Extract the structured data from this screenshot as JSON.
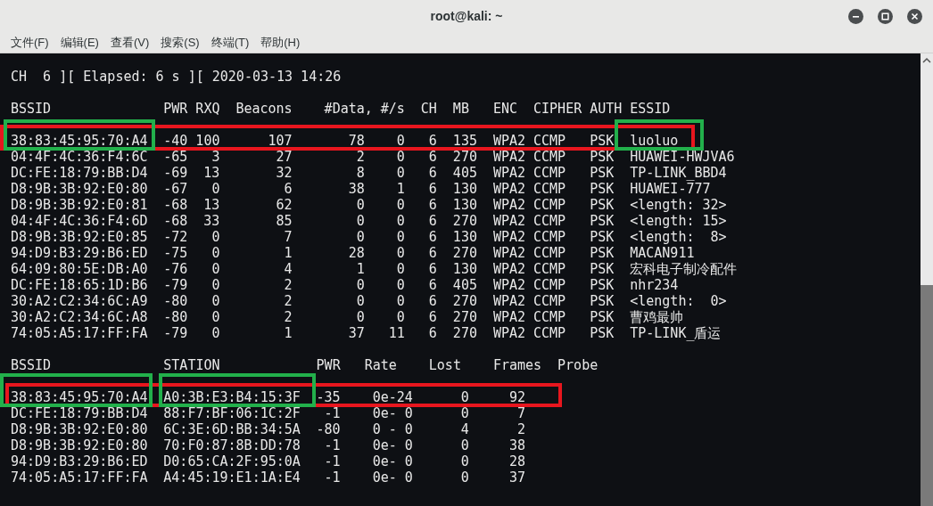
{
  "window": {
    "title": "root@kali: ~"
  },
  "menu": [
    "文件(F)",
    "编辑(E)",
    "查看(V)",
    "搜索(S)",
    "终端(T)",
    "帮助(H)"
  ],
  "status_line": "CH  6 ][ Elapsed: 6 s ][ 2020-03-13 14:26",
  "ap_table": {
    "columns": [
      "BSSID",
      "PWR",
      "RXQ",
      "Beacons",
      "#Data,",
      "#/s",
      "CH",
      "MB",
      "ENC",
      "CIPHER",
      "AUTH",
      "ESSID"
    ],
    "rows": [
      [
        "38:83:45:95:70:A4",
        "-40",
        "100",
        "107",
        "78",
        "0",
        "6",
        "135",
        "WPA2",
        "CCMP",
        "PSK",
        "luoluo"
      ],
      [
        "04:4F:4C:36:F4:6C",
        "-65",
        "3",
        "27",
        "2",
        "0",
        "6",
        "270",
        "WPA2",
        "CCMP",
        "PSK",
        "HUAWEI-HWJVA6"
      ],
      [
        "DC:FE:18:79:BB:D4",
        "-69",
        "13",
        "32",
        "8",
        "0",
        "6",
        "405",
        "WPA2",
        "CCMP",
        "PSK",
        "TP-LINK_BBD4"
      ],
      [
        "D8:9B:3B:92:E0:80",
        "-67",
        "0",
        "6",
        "38",
        "1",
        "6",
        "130",
        "WPA2",
        "CCMP",
        "PSK",
        "HUAWEI-777"
      ],
      [
        "D8:9B:3B:92:E0:81",
        "-68",
        "13",
        "62",
        "0",
        "0",
        "6",
        "130",
        "WPA2",
        "CCMP",
        "PSK",
        "<length: 32>"
      ],
      [
        "04:4F:4C:36:F4:6D",
        "-68",
        "33",
        "85",
        "0",
        "0",
        "6",
        "270",
        "WPA2",
        "CCMP",
        "PSK",
        "<length: 15>"
      ],
      [
        "D8:9B:3B:92:E0:85",
        "-72",
        "0",
        "7",
        "0",
        "0",
        "6",
        "130",
        "WPA2",
        "CCMP",
        "PSK",
        "<length:  8>"
      ],
      [
        "94:D9:B3:29:B6:ED",
        "-75",
        "0",
        "1",
        "28",
        "0",
        "6",
        "270",
        "WPA2",
        "CCMP",
        "PSK",
        "MACAN911"
      ],
      [
        "64:09:80:5E:DB:A0",
        "-76",
        "0",
        "4",
        "1",
        "0",
        "6",
        "130",
        "WPA2",
        "CCMP",
        "PSK",
        "宏科电子制冷配件"
      ],
      [
        "DC:FE:18:65:1D:B6",
        "-79",
        "0",
        "2",
        "0",
        "0",
        "6",
        "405",
        "WPA2",
        "CCMP",
        "PSK",
        "nhr234"
      ],
      [
        "30:A2:C2:34:6C:A9",
        "-80",
        "0",
        "2",
        "0",
        "0",
        "6",
        "270",
        "WPA2",
        "CCMP",
        "PSK",
        "<length:  0>"
      ],
      [
        "30:A2:C2:34:6C:A8",
        "-80",
        "0",
        "2",
        "0",
        "0",
        "6",
        "270",
        "WPA2",
        "CCMP",
        "PSK",
        "曹鸡最帅"
      ],
      [
        "74:05:A5:17:FF:FA",
        "-79",
        "0",
        "1",
        "37",
        "11",
        "6",
        "270",
        "WPA2",
        "CCMP",
        "PSK",
        "TP-LINK_盾运"
      ]
    ]
  },
  "station_table": {
    "columns": [
      "BSSID",
      "STATION",
      "PWR",
      "Rate",
      "Lost",
      "Frames",
      "Probe"
    ],
    "rows": [
      [
        "38:83:45:95:70:A4",
        "A0:3B:E3:B4:15:3F",
        "-35",
        "0e-24",
        "0",
        "92"
      ],
      [
        "DC:FE:18:79:BB:D4",
        "88:F7:BF:06:1C:2F",
        "-1",
        "0e- 0",
        "0",
        "7"
      ],
      [
        "D8:9B:3B:92:E0:80",
        "6C:3E:6D:BB:34:5A",
        "-80",
        "0 - 0",
        "4",
        "2"
      ],
      [
        "D8:9B:3B:92:E0:80",
        "70:F0:87:8B:DD:78",
        "-1",
        "0e- 0",
        "0",
        "38"
      ],
      [
        "94:D9:B3:29:B6:ED",
        "D0:65:CA:2F:95:0A",
        "-1",
        "0e- 0",
        "0",
        "28"
      ],
      [
        "74:05:A5:17:FF:FA",
        "A4:45:19:E1:1A:E4",
        "-1",
        "0e- 0",
        "0",
        "37"
      ]
    ]
  },
  "annotations": [
    {
      "color": "#e8161e"
    },
    {
      "color": "#22b04b"
    },
    {
      "color": "#22b04b"
    },
    {
      "color": "#e8161e"
    },
    {
      "color": "#22b04b"
    },
    {
      "color": "#22b04b"
    }
  ]
}
